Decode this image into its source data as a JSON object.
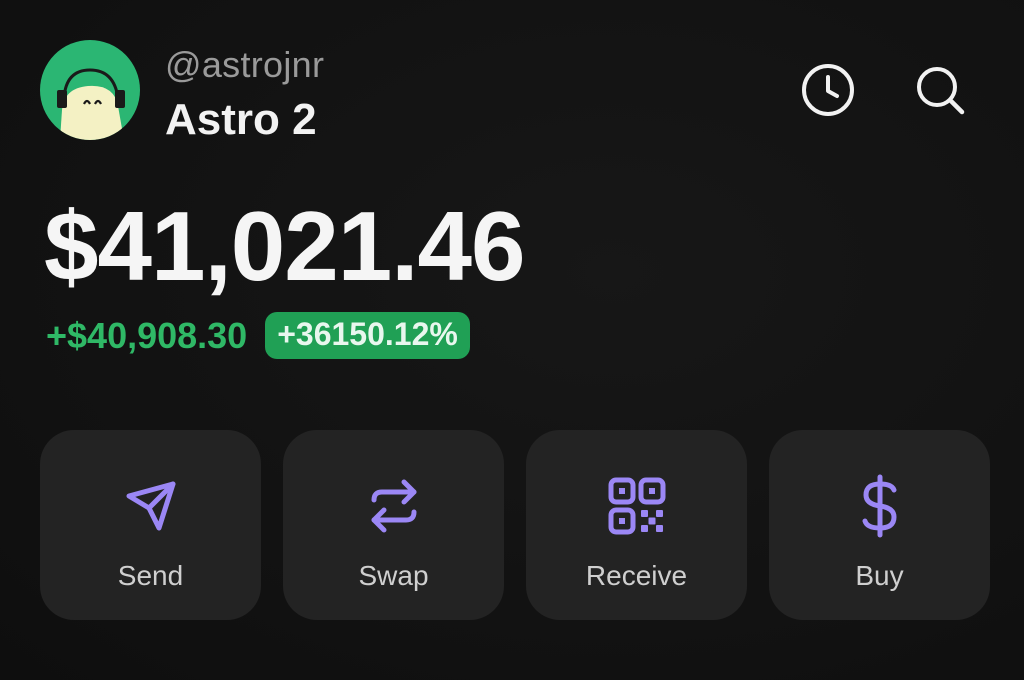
{
  "profile": {
    "handle": "@astrojnr",
    "account_name": "Astro 2",
    "avatar_icon": "astronaut-avatar",
    "avatar_bg_color": "#2bb673"
  },
  "header_icons": {
    "history": "clock-icon",
    "search": "search-icon"
  },
  "portfolio": {
    "balance": "$41,021.46",
    "change_amount": "+$40,908.30",
    "change_percent": "+36150.12%",
    "positive_color": "#2fb866"
  },
  "actions": [
    {
      "label": "Send",
      "icon": "send-icon"
    },
    {
      "label": "Swap",
      "icon": "swap-icon"
    },
    {
      "label": "Receive",
      "icon": "qr-code-icon"
    },
    {
      "label": "Buy",
      "icon": "dollar-icon"
    }
  ],
  "accent_color": "#9b87f5"
}
